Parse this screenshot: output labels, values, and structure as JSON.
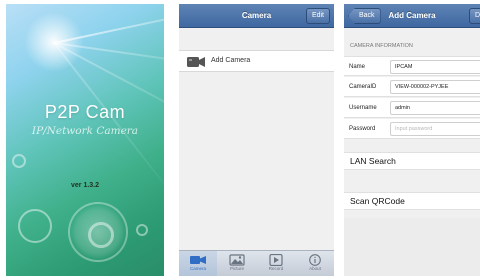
{
  "splash": {
    "app_title": "P2P Cam",
    "app_subtitle": "IP/Network Camera",
    "version": "ver 1.3.2"
  },
  "camera_list": {
    "title": "Camera",
    "edit_label": "Edit",
    "items": [
      {
        "label": "Add Camera",
        "icon": "camera-icon"
      }
    ],
    "tabs": [
      {
        "label": "Camera",
        "icon": "camera-icon",
        "active": true
      },
      {
        "label": "Picture",
        "icon": "picture-icon",
        "active": false
      },
      {
        "label": "Record",
        "icon": "record-icon",
        "active": false
      },
      {
        "label": "About",
        "icon": "info-icon",
        "active": false
      }
    ]
  },
  "add_camera": {
    "back_label": "Back",
    "title": "Add Camera",
    "done_label": "Do",
    "section_title": "CAMERA INFORMATION",
    "fields": {
      "name": {
        "label": "Name",
        "value": "IPCAM"
      },
      "camera_id": {
        "label": "CameraID",
        "value": "VIEW-000002-PYJEE"
      },
      "username": {
        "label": "Username",
        "value": "admin"
      },
      "password": {
        "label": "Password",
        "placeholder": "Input password"
      }
    },
    "lan_search_label": "LAN Search",
    "scan_qrcode_label": "Scan QRCode"
  },
  "colors": {
    "navbar": "#4a70a6",
    "active_tab_text": "#2f6ec4"
  }
}
